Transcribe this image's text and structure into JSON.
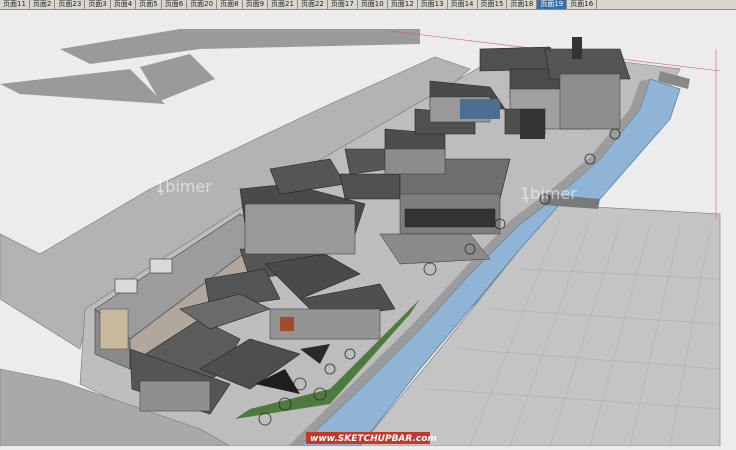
{
  "tabs": [
    {
      "label": "页面11",
      "active": false
    },
    {
      "label": "页面2",
      "active": false
    },
    {
      "label": "页面23",
      "active": false
    },
    {
      "label": "页面3",
      "active": false
    },
    {
      "label": "页面4",
      "active": false
    },
    {
      "label": "页面5",
      "active": false
    },
    {
      "label": "页面6",
      "active": false
    },
    {
      "label": "页面20",
      "active": false
    },
    {
      "label": "页面8",
      "active": false
    },
    {
      "label": "页面9",
      "active": false
    },
    {
      "label": "页面21",
      "active": false
    },
    {
      "label": "页面22",
      "active": false
    },
    {
      "label": "页面17",
      "active": false
    },
    {
      "label": "页面10",
      "active": false
    },
    {
      "label": "页面12",
      "active": false
    },
    {
      "label": "页面13",
      "active": false
    },
    {
      "label": "页面14",
      "active": false
    },
    {
      "label": "页面15",
      "active": false
    },
    {
      "label": "页面18",
      "active": false
    },
    {
      "label": "页面19",
      "active": true
    },
    {
      "label": "页面16",
      "active": false
    }
  ],
  "viewport": {
    "watermark_left": "1̧bimer",
    "watermark_right": "1̧bimer",
    "site_label": "www.SKETCHUPBAR.com"
  },
  "colors": {
    "active_tab": "#3a6ea5",
    "water": "#8fb4d6",
    "ground": "#b9b9b9",
    "roof": "#4a4a4a",
    "site_label_bg": "#c0392b"
  }
}
